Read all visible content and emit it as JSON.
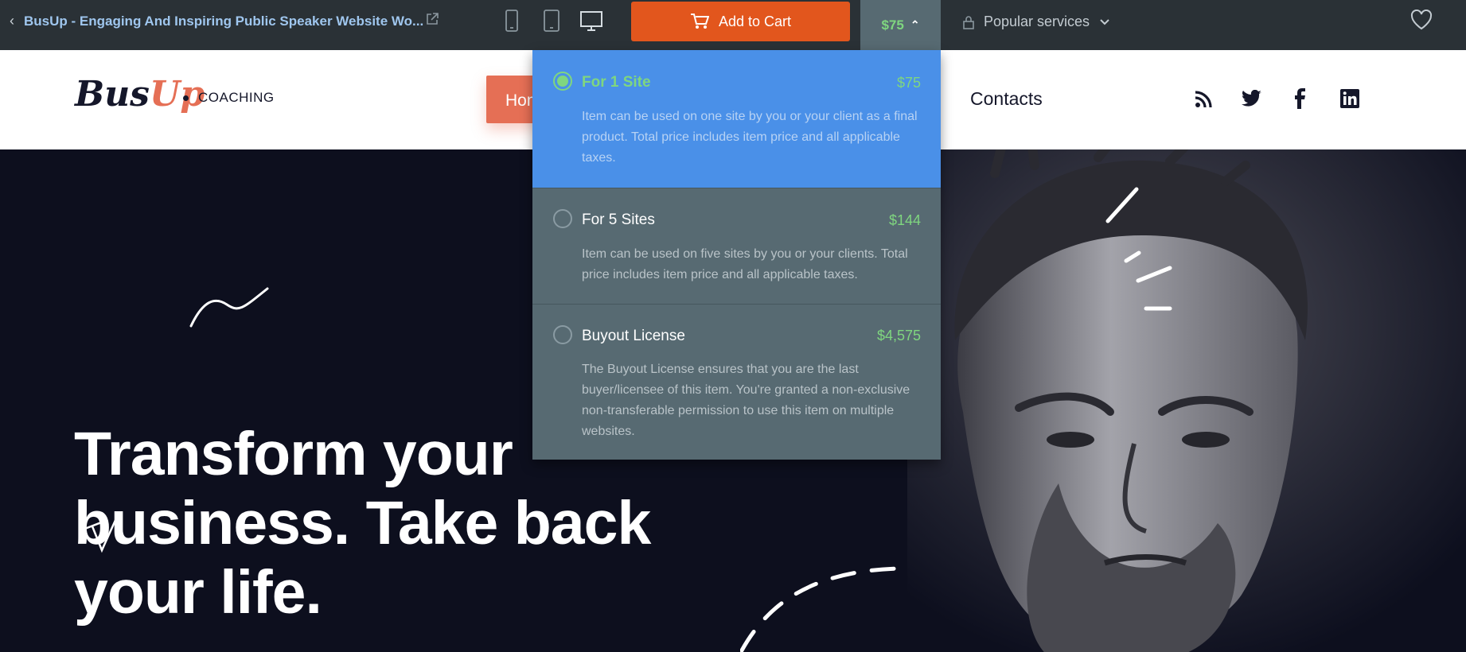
{
  "topbar": {
    "back_icon": "chevron-left-icon",
    "title": "BusUp - Engaging And Inspiring Public Speaker Website Wo...",
    "external_icon": "external-link-icon",
    "devices": [
      "mobile-icon",
      "tablet-icon",
      "desktop-icon"
    ],
    "add_to_cart": "Add to Cart",
    "price": "$75",
    "popular_services": "Popular services",
    "favorite_icon": "heart-icon"
  },
  "site_header": {
    "logo_bus": "Bus",
    "logo_up": "Up",
    "logo_sub": "COACHING",
    "nav_home": "Home",
    "nav_contacts": "Contacts",
    "social": [
      "rss-icon",
      "twitter-icon",
      "facebook-icon",
      "linkedin-icon"
    ]
  },
  "hero": {
    "line1": "Transform your",
    "line2": "business. Take back",
    "line3": "your life."
  },
  "license_dropdown": {
    "options": [
      {
        "name": "For 1 Site",
        "price": "$75",
        "selected": true,
        "description": "Item can be used on one site by you or your client as a final product. Total price includes item price and all applicable taxes."
      },
      {
        "name": "For 5 Sites",
        "price": "$144",
        "selected": false,
        "description": "Item can be used on five sites by you or your clients. Total price includes item price and all applicable taxes."
      },
      {
        "name": "Buyout License",
        "price": "$4,575",
        "selected": false,
        "description": "The Buyout License ensures that you are the last buyer/licensee of this item. You're granted a non-exclusive non-transferable permission to use this item on multiple websites."
      }
    ]
  },
  "colors": {
    "topbar_bg": "#2a3136",
    "cart_orange": "#e2561d",
    "price_green": "#7fd67f",
    "selected_blue": "#4a90e8",
    "brand_coral": "#e56f55",
    "hero_bg": "#0d0f1e"
  }
}
